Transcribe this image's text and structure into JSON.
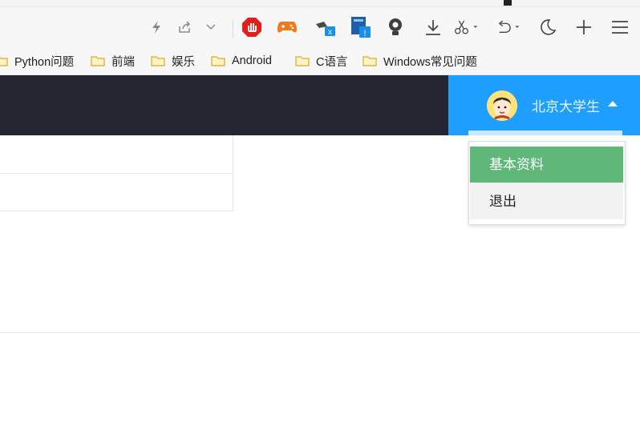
{
  "browser": {
    "toolbar_icons": [
      "lightning-icon",
      "share-icon",
      "chevron-down-icon",
      "adblock-icon",
      "game-controller-icon",
      "screenshot-x-icon",
      "note-alert-icon",
      "bulb-icon",
      "download-icon",
      "scissors-icon",
      "undo-icon",
      "moon-icon",
      "plus-icon",
      "menu-icon"
    ],
    "bookmarks": [
      "Python问题",
      "前端",
      "娱乐",
      "Android",
      "C语言",
      "Windows常见问题"
    ]
  },
  "header": {
    "user_name": "北京大学生"
  },
  "dropdown": {
    "items": [
      {
        "label": "基本资料",
        "active": true
      },
      {
        "label": "退出",
        "active": false
      }
    ]
  },
  "colors": {
    "navbar_bg": "#232630",
    "user_bg": "#1e9fff",
    "active_item_bg": "#5fb878"
  }
}
